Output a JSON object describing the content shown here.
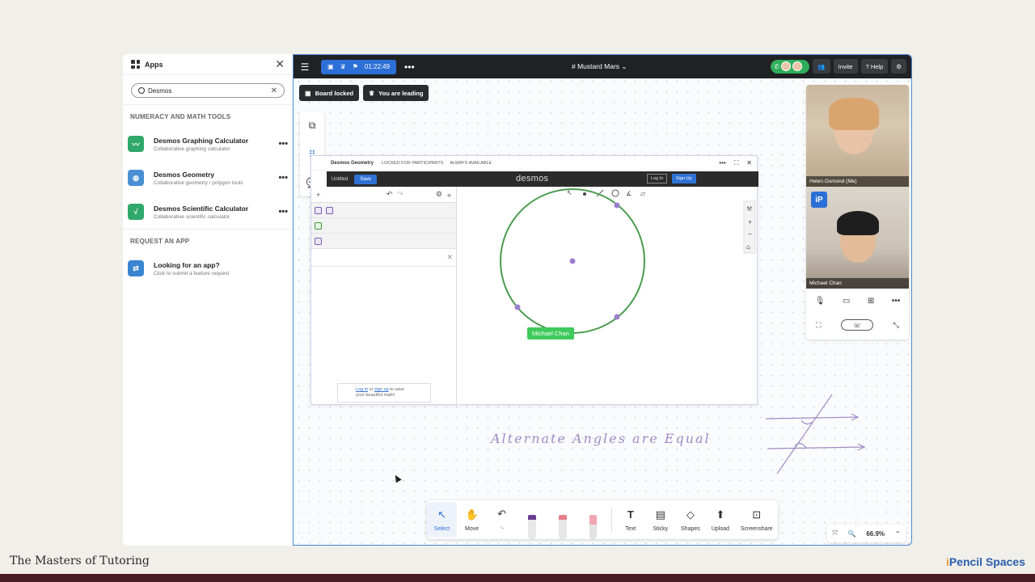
{
  "apps_panel": {
    "title": "Apps",
    "search_value": "Desmos",
    "section_math": "NUMERACY AND MATH TOOLS",
    "items": [
      {
        "name": "Desmos Graphing Calculator",
        "desc": "Collaborative graphing calculator",
        "color": "#2fa86a"
      },
      {
        "name": "Desmos Geometry",
        "desc": "Collaborative geometry / polygon tools",
        "color": "#4a8fd4"
      },
      {
        "name": "Desmos Scientific Calculator",
        "desc": "Collaborative scientific calculator",
        "color": "#2fa86a"
      }
    ],
    "section_request": "REQUEST AN APP",
    "request": {
      "name": "Looking for an app?",
      "desc": "Click to submit a feature request",
      "color": "#3a85d2"
    }
  },
  "topbar": {
    "timer": "01:22:49",
    "space_name": "Mustard Mars",
    "invite_label": "Invite",
    "help_label": "Help"
  },
  "chips": {
    "board_locked": "Board locked",
    "leading": "You are leading"
  },
  "desmos": {
    "app_title": "Desmos Geometry",
    "locked_meta": "LOCKED FOR PARTICIPANTS",
    "available_meta": "ALWAYS AVAILABLE",
    "untitled": "Untitled",
    "save": "Save",
    "logo": "desmos",
    "login": "Log In",
    "signup": "Sign Up",
    "promo_login": "Log in",
    "promo_or": "or",
    "promo_signup": "sign up",
    "promo_rest1": "to save",
    "promo_rest2": "your beautiful math!",
    "cursor_name": "Michael Chan"
  },
  "video": {
    "participant1": "Helen Osmond (Me)",
    "participant2": "Michael Chan"
  },
  "board": {
    "handwriting": "Alternate Angles are Equal"
  },
  "toolbar": {
    "select": "Select",
    "move": "Move",
    "text": "Text",
    "sticky": "Sticky",
    "shapes": "Shapes",
    "upload": "Upload",
    "screenshare": "Screenshare"
  },
  "zoom_level": "66.9%",
  "footer": {
    "left": "The Masters of Tutoring",
    "right_prefix": "i",
    "right": "Pencil Spaces"
  }
}
